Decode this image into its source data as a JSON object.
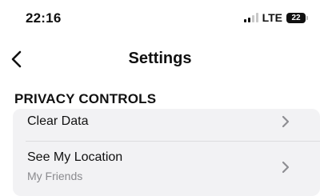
{
  "status_bar": {
    "time": "22:16",
    "network": "LTE",
    "battery": "22"
  },
  "nav": {
    "title": "Settings",
    "back_icon": "chevron-left-icon"
  },
  "section": {
    "header": "PRIVACY CONTROLS",
    "items": [
      {
        "label": "Clear Data",
        "icon": "chevron-right-icon"
      },
      {
        "label": "See My Location",
        "value": "My Friends",
        "icon": "chevron-right-icon"
      }
    ]
  },
  "colors": {
    "background": "#ffffff",
    "card": "#f2f2f4",
    "secondary_text": "#8a8a8e",
    "chevron": "#8e8e93"
  }
}
